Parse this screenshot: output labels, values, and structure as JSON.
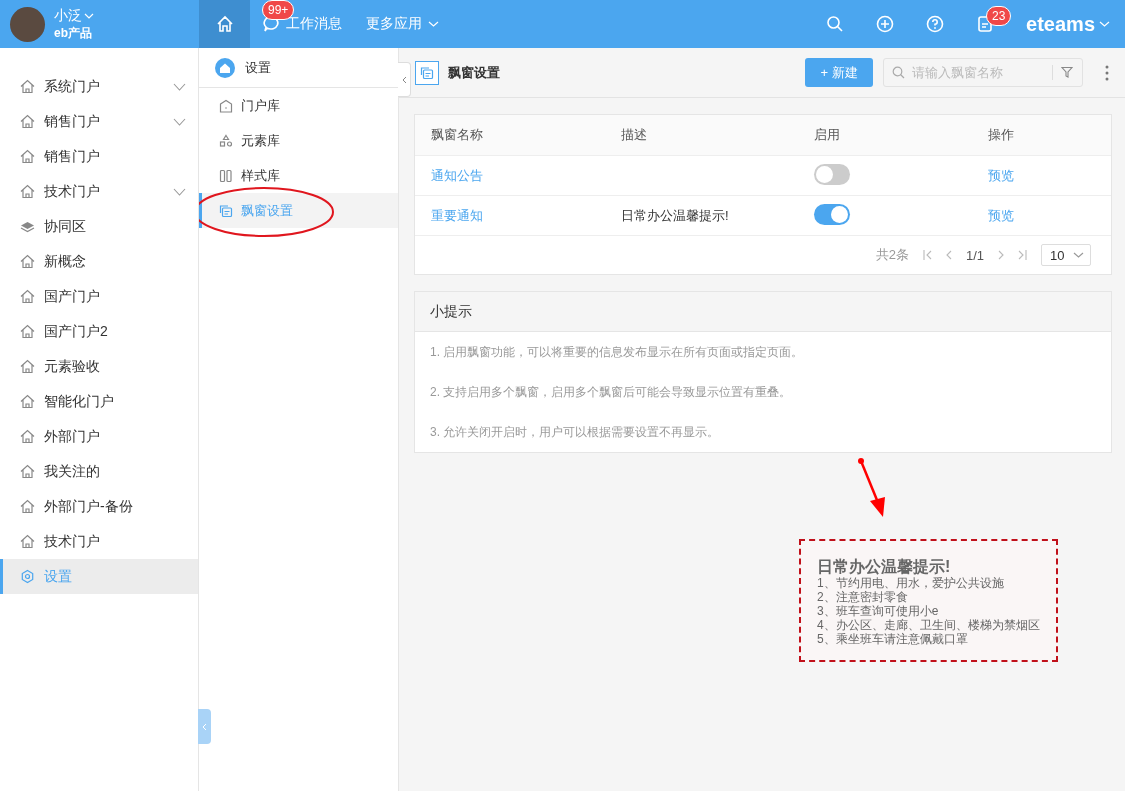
{
  "topbar": {
    "user": {
      "name": "小泛",
      "org": "eb产品"
    },
    "home": {
      "selected": true
    },
    "nav": [
      {
        "kind": "message",
        "label": "工作消息",
        "badge": "99+"
      },
      {
        "kind": "more",
        "label": "更多应用"
      }
    ],
    "actions": [
      {
        "kind": "search"
      },
      {
        "kind": "add"
      },
      {
        "kind": "help"
      },
      {
        "kind": "todo",
        "badge": "23"
      }
    ],
    "brand": "eteams"
  },
  "sidebar": {
    "items": [
      {
        "kind": "portal",
        "label": "系统门户",
        "expandable": true,
        "selected": false
      },
      {
        "kind": "portal",
        "label": "销售门户",
        "expandable": true,
        "selected": false
      },
      {
        "kind": "portal",
        "label": "销售门户",
        "expandable": false,
        "selected": false
      },
      {
        "kind": "portal",
        "label": "技术门户",
        "expandable": true,
        "selected": false
      },
      {
        "kind": "group",
        "label": "协同区",
        "expandable": false,
        "selected": false
      },
      {
        "kind": "portal",
        "label": "新概念",
        "expandable": false,
        "selected": false
      },
      {
        "kind": "portal",
        "label": "国产门户",
        "expandable": false,
        "selected": false
      },
      {
        "kind": "portal",
        "label": "国产门户2",
        "expandable": false,
        "selected": false
      },
      {
        "kind": "portal",
        "label": "元素验收",
        "expandable": false,
        "selected": false
      },
      {
        "kind": "portal",
        "label": "智能化门户",
        "expandable": false,
        "selected": false
      },
      {
        "kind": "portal",
        "label": "外部门户",
        "expandable": false,
        "selected": false
      },
      {
        "kind": "portal",
        "label": "我关注的",
        "expandable": false,
        "selected": false
      },
      {
        "kind": "portal",
        "label": "外部门户-备份",
        "expandable": false,
        "selected": false
      },
      {
        "kind": "portal",
        "label": "技术门户",
        "expandable": false,
        "selected": false
      },
      {
        "kind": "settings",
        "label": "设置",
        "expandable": false,
        "selected": true
      }
    ]
  },
  "submenu": {
    "title": "设置",
    "items": [
      {
        "kind": "portals",
        "label": "门户库",
        "selected": false
      },
      {
        "kind": "elements",
        "label": "元素库",
        "selected": false
      },
      {
        "kind": "styles",
        "label": "样式库",
        "selected": false
      },
      {
        "kind": "popups",
        "label": "飘窗设置",
        "selected": true
      }
    ]
  },
  "page": {
    "title": "飘窗设置",
    "new_button": "+ 新建",
    "search": {
      "placeholder": "请输入飘窗名称"
    }
  },
  "table": {
    "columns": [
      "飘窗名称",
      "描述",
      "启用",
      "操作"
    ],
    "rows": [
      {
        "name": "通知公告",
        "description": "",
        "enabled": false,
        "action": "预览"
      },
      {
        "name": "重要通知",
        "description": "日常办公温馨提示!",
        "enabled": true,
        "action": "预览"
      }
    ],
    "pagination": {
      "total": "共2条",
      "page": "1/1",
      "page_size": "10"
    }
  },
  "tips": {
    "title": "小提示",
    "items": [
      "1. 启用飘窗功能，可以将重要的信息发布显示在所有页面或指定页面。",
      "2. 支持启用多个飘窗，启用多个飘窗后可能会导致显示位置有重叠。",
      "3. 允许关闭开启时，用户可以根据需要设置不再显示。"
    ]
  },
  "popup": {
    "title": "日常办公温馨提示!",
    "lines": [
      "1、节约用电、用水，爱护公共设施",
      "2、注意密封零食",
      "3、班车查询可使用小e",
      "4、办公区、走廊、卫生间、楼梯为禁烟区",
      "5、乘坐班车请注意佩戴口罩"
    ]
  }
}
